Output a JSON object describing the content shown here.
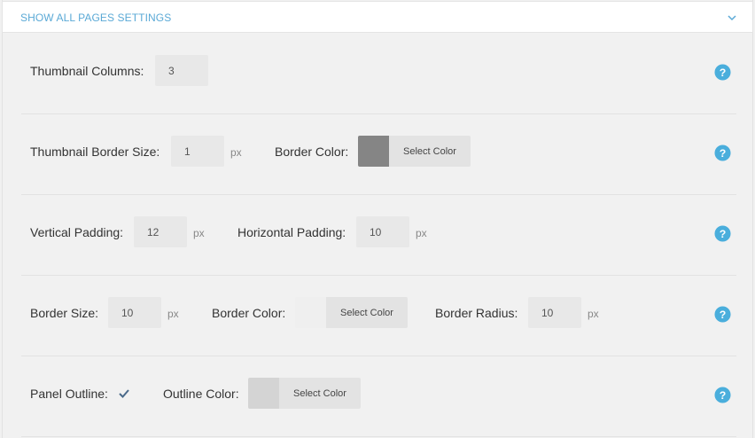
{
  "header": {
    "title": "SHOW ALL PAGES SETTINGS",
    "chevron_icon": "chevron-down-icon"
  },
  "rows": [
    {
      "thumb_columns_label": "Thumbnail Columns:",
      "thumb_columns_value": "3"
    },
    {
      "thumb_border_size_label": "Thumbnail Border Size:",
      "thumb_border_size_value": "1",
      "unit": "px",
      "border_color_label": "Border Color:",
      "select_color": "Select Color",
      "swatch_color": "#858585"
    },
    {
      "vpad_label": "Vertical Padding:",
      "vpad_value": "12",
      "vpad_unit": "px",
      "hpad_label": "Horizontal Padding:",
      "hpad_value": "10",
      "hpad_unit": "px"
    },
    {
      "border_size_label": "Border Size:",
      "border_size_value": "10",
      "border_size_unit": "px",
      "border_color_label": "Border Color:",
      "select_color": "Select Color",
      "swatch_color": "#efefef",
      "border_radius_label": "Border Radius:",
      "border_radius_value": "10",
      "border_radius_unit": "px"
    },
    {
      "panel_outline_label": "Panel Outline:",
      "panel_outline_checked": true,
      "outline_color_label": "Outline Color:",
      "select_color": "Select Color",
      "swatch_color": "#d4d4d4"
    }
  ],
  "help_icon": "question-circle-icon",
  "colors": {
    "accent": "#5aa9d6",
    "help": "#4aaedc"
  }
}
